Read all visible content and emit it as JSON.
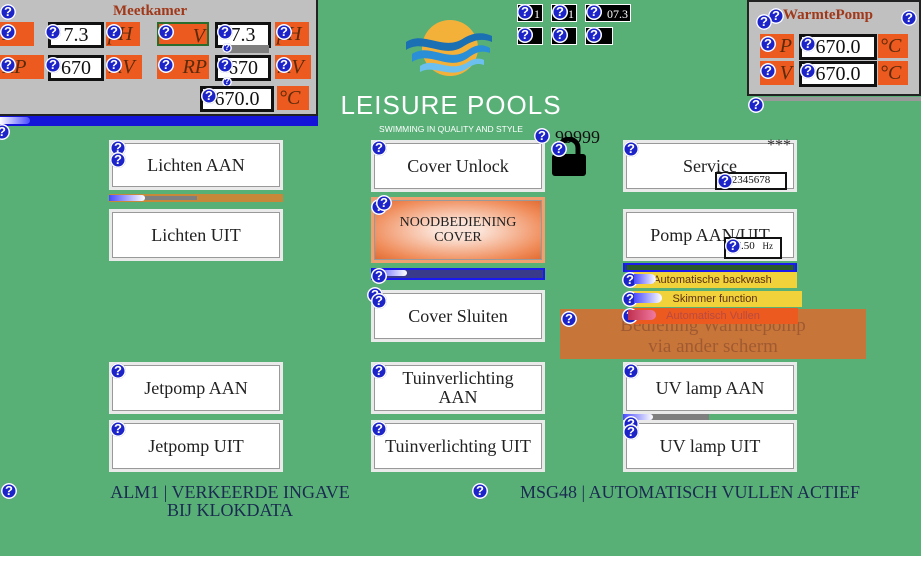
{
  "meetkamer": {
    "title": "Meetkamer",
    "row1": {
      "label_a": "P",
      "value_a": "7.3",
      "unit_a": "pH",
      "label_b": "V",
      "value_b": "7.3",
      "unit_b": "pH"
    },
    "row2": {
      "label_a": "RP",
      "value_a": "670",
      "unit_a": "mV",
      "label_b": "RP",
      "value_b": "670",
      "unit_b": "mV"
    },
    "row3": {
      "value": "670.0",
      "unit": "°C"
    }
  },
  "warmtepomp": {
    "title": "WarmtePomp",
    "row1": {
      "label": "P",
      "value": "670.0",
      "unit": "°C"
    },
    "row2": {
      "label": "V",
      "value": "670.0",
      "unit": "°C"
    }
  },
  "top_center": {
    "v1": "1",
    "v2": "1",
    "v3": "07.3"
  },
  "logo": {
    "brand": "LEISURE POOLS",
    "tagline": "SWIMMING IN QUALITY AND STYLE"
  },
  "lock": {
    "code": "99999"
  },
  "buttons": {
    "lichten_aan": "Lichten AAN",
    "lichten_uit": "Lichten UIT",
    "cover_unlock": "Cover Unlock",
    "noodbediening_line1": "NOODBEDIENING",
    "noodbediening_line2": "COVER",
    "cover_sluiten": "Cover Sluiten",
    "service": "Service",
    "pomp": "Pomp AAN/UIT",
    "jetpomp_aan": "Jetpomp AAN",
    "jetpomp_uit": "Jetpomp UIT",
    "tuin_aan_line1": "Tuinverlichting",
    "tuin_aan_line2": "AAN",
    "tuin_uit": "Tuinverlichting UIT",
    "uv_aan": "UV lamp AAN",
    "uv_uit": "UV lamp UIT"
  },
  "service": {
    "stars": "***",
    "code": "2345678"
  },
  "pomp": {
    "freq": "37.50",
    "unit": "Hz"
  },
  "toggles": {
    "t1": "Automatische backwash",
    "t2": "Skimmer function",
    "t3": "Automatisch Vullen"
  },
  "warmtepomp_overlay": {
    "line1": "Bediening Warmtepomp",
    "line2": "via ander scherm"
  },
  "alarms": {
    "alm_line1": "ALM1 | VERKEERDE INGAVE",
    "alm_line2": "BIJ KLOKDATA",
    "msg": "MSG48 | AUTOMATISCH VULLEN ACTIEF"
  },
  "colors": {
    "background": "#58b077",
    "accent_orange": "#ec5a1f",
    "help_blue": "#1b23c9"
  }
}
